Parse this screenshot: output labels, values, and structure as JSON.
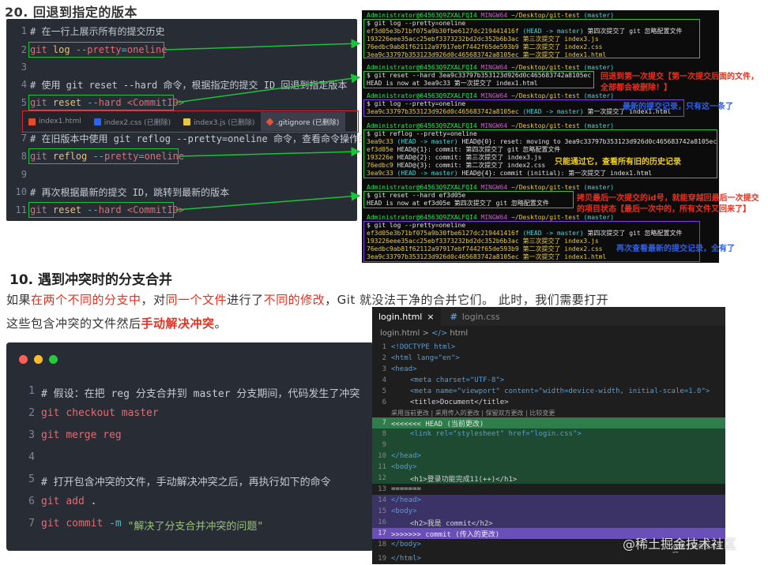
{
  "section20": {
    "title": "20. 回退到指定的版本"
  },
  "code1": {
    "lines": [
      {
        "num": "1",
        "text": "# 在一行上展示所有的提交历史"
      },
      {
        "num": "2",
        "cmd": "git",
        "sub": "log",
        "op": "--",
        "kw2": "pretty",
        "eq": "=",
        "val": "oneline"
      },
      {
        "num": "3"
      },
      {
        "num": "4",
        "text": "# 使用 git reset --hard 命令，根据指定的提交 ID 回退到指定版本"
      },
      {
        "num": "5",
        "cmd": "git",
        "sub": "reset",
        "op": "--",
        "kw2": "hard",
        "val": "<CommitID>"
      },
      {
        "num": "7",
        "text": "# 在旧版本中使用 git reflog --pretty=oneline 命令，查看命令操作的历史"
      },
      {
        "num": "8",
        "cmd": "git",
        "sub": "reflog",
        "op": "--",
        "kw2": "pretty",
        "eq": "=",
        "val": "oneline"
      },
      {
        "num": "9"
      },
      {
        "num": "10",
        "text": "# 再次根据最新的提交 ID，跳转到最新的版本"
      },
      {
        "num": "11",
        "cmd": "git",
        "sub": "reset",
        "op": "--",
        "kw2": "hard",
        "val": "<CommitID>"
      }
    ],
    "tabs": [
      "index1.html",
      "index2.css (已删除)",
      "index3.js (已删除)",
      ".gitignore (已删除)"
    ]
  },
  "terminal": {
    "prompt_user": "Administrator@64563Q9ZXALFQI4",
    "prompt_env": "MINGW64",
    "prompt_path": "~/Desktop/git-test",
    "prompt_branch": "(master)",
    "block1": [
      "$ git log --pretty=oneline",
      "ef3d05e3b71bf075a9b30fbe6127dc219441416f",
      "(HEAD -> master)",
      "第四次提交了 git 忽略配置文件",
      "193226eee35acc25ebf3373232bd2dc352b6b3ac 第三次提交了  index3.js",
      "76edbc9ab81f62112a97917ebf7442f65de593b9 第二次提交了  index2.css",
      "3ea9c33797b353123d926d0c465683742a8105ec 第一次提交了  index1.html"
    ],
    "block2": [
      "$ git reset --hard 3ea9c33797b353123d926d0c465683742a8105ec",
      "HEAD is now at 3ea9c33 第一次提交了  index1.html"
    ],
    "block3": [
      "$ git log --pretty=oneline",
      "3ea9c33797b353123d926d0c465683742a8105ec",
      "(HEAD -> master)",
      "第一次提交了  index1.html"
    ],
    "block4": [
      "$ git reflog --pretty=oneline",
      "3ea9c33",
      "(HEAD -> master)",
      "HEAD@{0}: reset: moving to 3ea9c33797b353123d926d0c465683742a8105ec",
      "ef3d05e",
      "HEAD@{1}: commit: 第四次提交了 git 忽略配置文件",
      "193226e",
      "HEAD@{2}: commit: 第三次提交了  index3.js",
      "76edbc9",
      "HEAD@{3}: commit: 第二次提交了  index2.css",
      "3ea9c33",
      "(HEAD -> master)",
      "HEAD@{4}: commit (initial): 第一次提交了  index1.html"
    ],
    "block5": [
      "$ git reset --hard ef3d05e",
      "HEAD is now at ef3d05e 第四次提交了 git 忽略配置文件"
    ],
    "block6": [
      "$ git log --pretty=oneline",
      "ef3d05e3b71bf075a9b30fbe6127dc219441416f",
      "(HEAD -> master)",
      "第四次提交了 git 忽略配置文件",
      "193226eee35acc25ebf3373232bd2dc352b6b3ac 第三次提交了  index3.js",
      "76edbc9ab81f62112a97917ebf7442f65de593b9 第二次提交了  index2.css",
      "3ea9c33797b353123d926d0c465683742a8105ec 第一次提交了  index1.html"
    ]
  },
  "annotations": {
    "a1_line1": "回退到第一次提交【第一次提交后面的文件，",
    "a1_line2": "全部都会被删除！】",
    "a2": "最新的提交记录，只有这一条了",
    "a3": "只能通过它，查看所有旧的历史记录",
    "a4_line1": "拷贝最后一次提交的id号，就能穿越回最后一次提交",
    "a4_line2": "的项目状态【最后一次中的，所有文件又回来了】",
    "a5": "再次查看最新的提交记录，全有了"
  },
  "section10": {
    "title": "10. 遇到冲突时的分支合并",
    "p1_a": "如果",
    "p1_b": "在两个不同的分支中",
    "p1_c": "，对",
    "p1_d": "同一个文件",
    "p1_e": "进行了",
    "p1_f": "不同的修改",
    "p1_g": "，Git 就没法干净的合并它们。 此时，我们需要打开",
    "p2_a": "这些包含冲突的文件然后",
    "p2_b": "手动解决冲突",
    "p2_c": "。"
  },
  "code2": {
    "lines": [
      {
        "num": "1",
        "text": "# 假设：在把 reg 分支合并到 master 分支期间，代码发生了冲突"
      },
      {
        "num": "2",
        "a": "git",
        "b": "checkout master"
      },
      {
        "num": "3",
        "a": "git",
        "b": "merge reg"
      },
      {
        "num": "4"
      },
      {
        "num": "5",
        "text": "# 打开包含冲突的文件，手动解决冲突之后，再执行如下的命令"
      },
      {
        "num": "6",
        "a": "git",
        "b": "add",
        "c": "."
      },
      {
        "num": "7",
        "a": "git",
        "b": "commit",
        "c": "-m",
        "d": "\"解决了分支合并冲突的问题\""
      }
    ]
  },
  "vscode": {
    "tab1": "login.html",
    "tab1_close": "×",
    "tab2": "login.css",
    "crumb1": "login.html",
    "crumb_sep": ">",
    "crumb2": "html",
    "codelens": "采用当前更改 | 采用传入的更改 | 保留双方更改 | 比较变更",
    "lines": [
      {
        "n": "1",
        "t": "<!DOCTYPE html>"
      },
      {
        "n": "2",
        "t": "<html lang=\"en\">"
      },
      {
        "n": "3",
        "t": "<head>"
      },
      {
        "n": "4",
        "t": "<meta charset=\"UTF-8\">"
      },
      {
        "n": "5",
        "t": "<meta name=\"viewport\" content=\"width=device-width, initial-scale=1.0\">"
      },
      {
        "n": "6",
        "t": "<title>Document</title>"
      },
      {
        "n": "7",
        "t": "<<<<<<< HEAD (当前更改)"
      },
      {
        "n": "8",
        "t": "<link rel=\"stylesheet\" href=\"login.css\">"
      },
      {
        "n": "9",
        "t": ""
      },
      {
        "n": "10",
        "t": "</head>"
      },
      {
        "n": "11",
        "t": "<body>"
      },
      {
        "n": "12",
        "t": "<h1>登录功能完成11(++)</h1>"
      },
      {
        "n": "13",
        "t": "======="
      },
      {
        "n": "14",
        "t": "</head>"
      },
      {
        "n": "15",
        "t": "<body>"
      },
      {
        "n": "16",
        "t": "<h2>我是 commit</h2>"
      },
      {
        "n": "17",
        "t": ">>>>>>> commit (传入的更改)"
      },
      {
        "n": "18",
        "t": "</body>"
      },
      {
        "n": "19",
        "t": "</html>"
      }
    ],
    "small_wm": "@稀土掘金技术社区"
  },
  "watermark": "@稀土掘金技术社区"
}
